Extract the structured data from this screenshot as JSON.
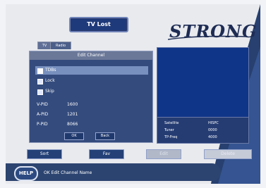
{
  "screen": {
    "title": "TV Lost",
    "brand": "STRONG"
  },
  "tabs": [
    {
      "label": "TV"
    },
    {
      "label": "Radio"
    }
  ],
  "edit_panel": {
    "heading": "Edit Channel",
    "options": [
      {
        "label": "TDBs"
      },
      {
        "label": "Lock"
      },
      {
        "label": "Skip"
      }
    ],
    "fields": [
      {
        "label": "V-PID",
        "value": "1600"
      },
      {
        "label": "A-PID",
        "value": "1201"
      },
      {
        "label": "P-PID",
        "value": "8066"
      }
    ],
    "ok_label": "OK",
    "back_label": "Back"
  },
  "info": {
    "rows": [
      {
        "label": "Satellite",
        "value": "HISPC"
      },
      {
        "label": "Tuner",
        "value": "0000"
      },
      {
        "label": "TP-Freq",
        "value": "4000"
      }
    ]
  },
  "bottom_buttons": [
    {
      "label": "Sort"
    },
    {
      "label": "Fav"
    },
    {
      "label": "Edit"
    },
    {
      "label": "Delete"
    }
  ],
  "help": {
    "badge": "HELP",
    "text": "OK Edit Channel Name"
  },
  "colors": {
    "primary": "#1f3a7a",
    "panel": "#344b7d",
    "accent": "#7890be",
    "background": "#e8eaee"
  }
}
